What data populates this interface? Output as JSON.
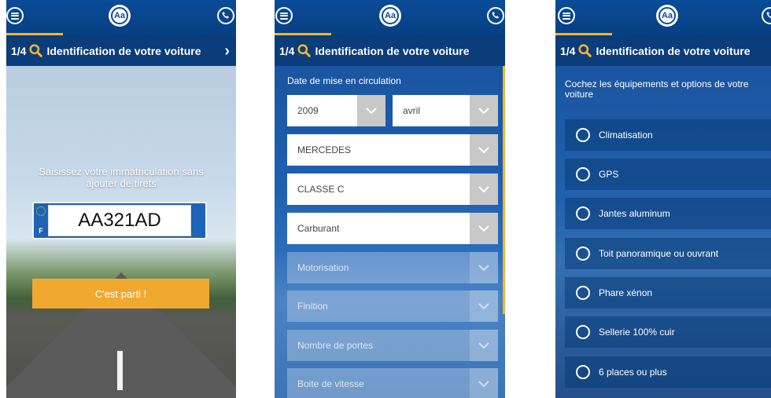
{
  "step": {
    "number": "1/4",
    "title": "Identification de votre voiture"
  },
  "logo_text": "Aa",
  "icons": {
    "menu": "menu-icon",
    "phone": "phone-icon",
    "search": "search-icon",
    "next": "chevron-right-icon"
  },
  "colors": {
    "brand_blue": "#0a4c98",
    "accent_orange": "#f0a92f",
    "highlight_yellow": "#f3b531"
  },
  "screen1": {
    "prompt_line1": "Saisissez votre immatriculation sans",
    "prompt_line2": "ajouter de tirets",
    "plate_country": "F",
    "plate_value": "AA321AD",
    "start_button": "C'est parti !"
  },
  "screen2": {
    "date_label": "Date de mise en circulation",
    "year": "2009",
    "month": "avril",
    "brand": "MERCEDES",
    "model": "CLASSE C",
    "fuel": "Carburant",
    "engine": "Motorisation",
    "finish": "Finition",
    "doors": "Nombre de portes",
    "gearbox": "Boite de vitesse"
  },
  "screen3": {
    "instruction": "Cochez les équipements et options de votre voiture",
    "options": [
      "Climatisation",
      "GPS",
      "Jantes aluminum",
      "Toit panoramique ou ouvrant",
      "Phare xénon",
      "Sellerie 100% cuir",
      "6 places ou plus"
    ]
  }
}
